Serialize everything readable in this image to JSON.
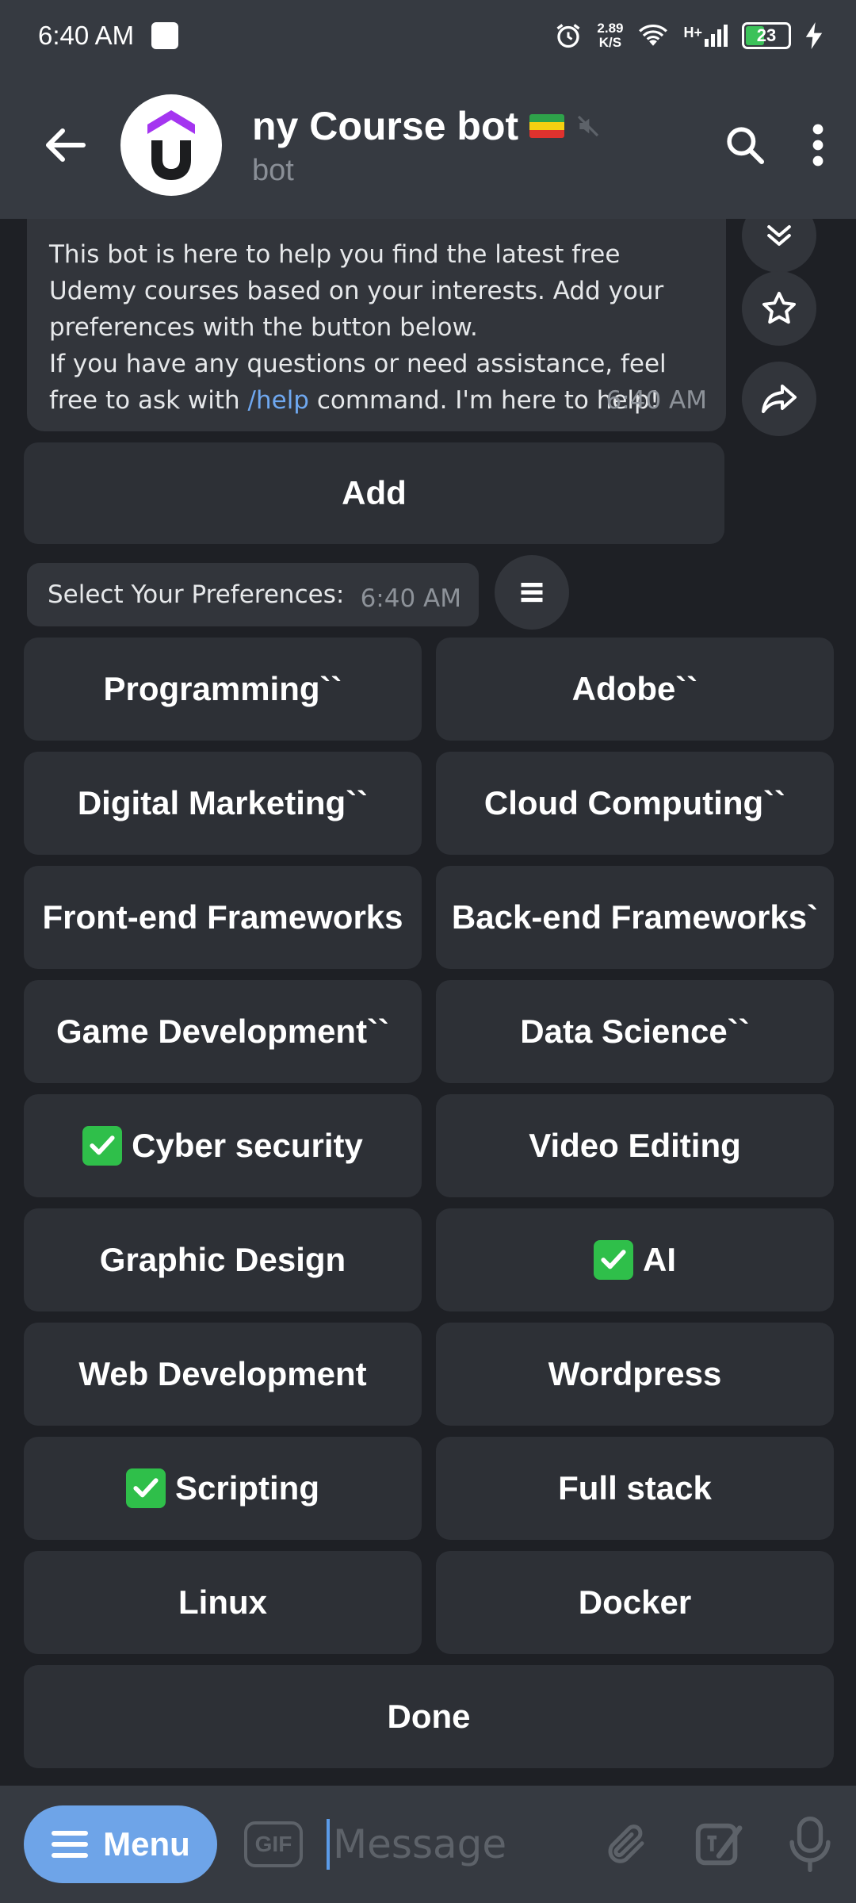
{
  "status_bar": {
    "time": "6:40 AM",
    "net_speed_value": "2.89",
    "net_speed_unit": "K/S",
    "network_type": "H+",
    "battery_level": "23"
  },
  "header": {
    "title": "ny Course bot",
    "subtitle": "bot",
    "avatar_letter": "U"
  },
  "message": {
    "line1": "This bot is here to help you find the latest free Udemy courses based on your interests. Add your preferences with the button below.",
    "line2_prefix": "If you have any questions or need assistance, feel free to ask with ",
    "line2_command": "/help",
    "line2_suffix": " command. I'm here to help!",
    "time": "6:40 AM"
  },
  "add_button_label": "Add",
  "preferences": {
    "label": "Select Your Preferences:",
    "time": "6:40 AM"
  },
  "options": [
    {
      "label": "Programming``",
      "checked": false
    },
    {
      "label": "Adobe``",
      "checked": false
    },
    {
      "label": "Digital Marketing``",
      "checked": false
    },
    {
      "label": "Cloud Computing``",
      "checked": false
    },
    {
      "label": "Front-end Frameworks",
      "checked": false
    },
    {
      "label": "Back-end Frameworks`",
      "checked": false
    },
    {
      "label": "Game Development``",
      "checked": false
    },
    {
      "label": "Data Science``",
      "checked": false
    },
    {
      "label": "Cyber security",
      "checked": true
    },
    {
      "label": "Video Editing",
      "checked": false
    },
    {
      "label": "Graphic Design",
      "checked": false
    },
    {
      "label": "AI",
      "checked": true
    },
    {
      "label": "Web Development",
      "checked": false
    },
    {
      "label": "Wordpress",
      "checked": false
    },
    {
      "label": "Scripting",
      "checked": true
    },
    {
      "label": "Full stack",
      "checked": false
    },
    {
      "label": "Linux",
      "checked": false
    },
    {
      "label": "Docker",
      "checked": false
    }
  ],
  "done_button_label": "Done",
  "input_bar": {
    "menu_label": "Menu",
    "gif_label": "GIF",
    "message_placeholder": "Message"
  },
  "colors": {
    "accent": "#6ea4e8",
    "check_green": "#2fbf4a",
    "button_bg": "#2d3036",
    "bar_bg": "#363a41"
  }
}
